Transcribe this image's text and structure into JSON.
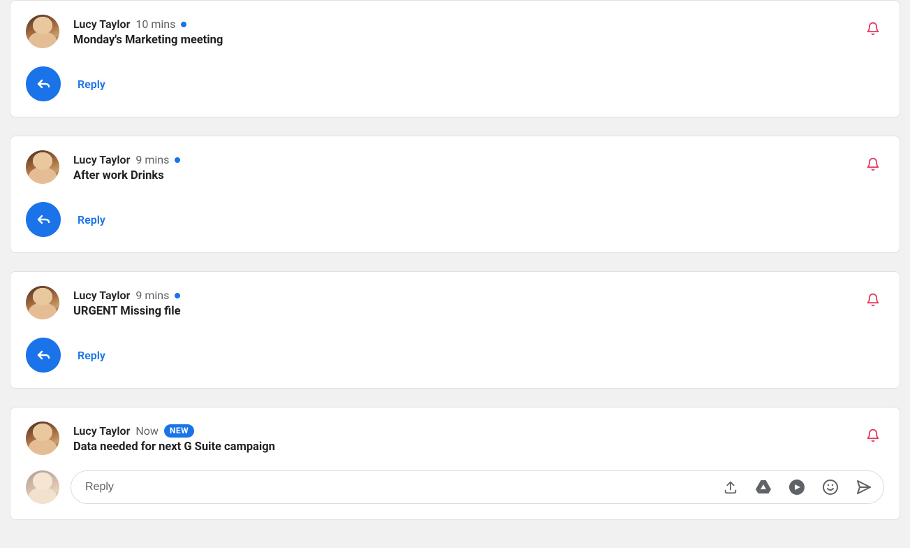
{
  "reply_label": "Reply",
  "compose": {
    "placeholder": "Reply"
  },
  "messages": [
    {
      "sender": "Lucy Taylor",
      "time": "10 mins",
      "subject": "Monday's Marketing meeting",
      "unread": true,
      "new_badge": false
    },
    {
      "sender": "Lucy Taylor",
      "time": "9 mins",
      "subject": "After work Drinks",
      "unread": true,
      "new_badge": false
    },
    {
      "sender": "Lucy Taylor",
      "time": "9 mins",
      "subject": "URGENT Missing file",
      "unread": true,
      "new_badge": false
    },
    {
      "sender": "Lucy Taylor",
      "time": "Now",
      "subject": "Data needed for next G Suite campaign",
      "unread": false,
      "new_badge": true,
      "new_label": "NEW"
    }
  ]
}
